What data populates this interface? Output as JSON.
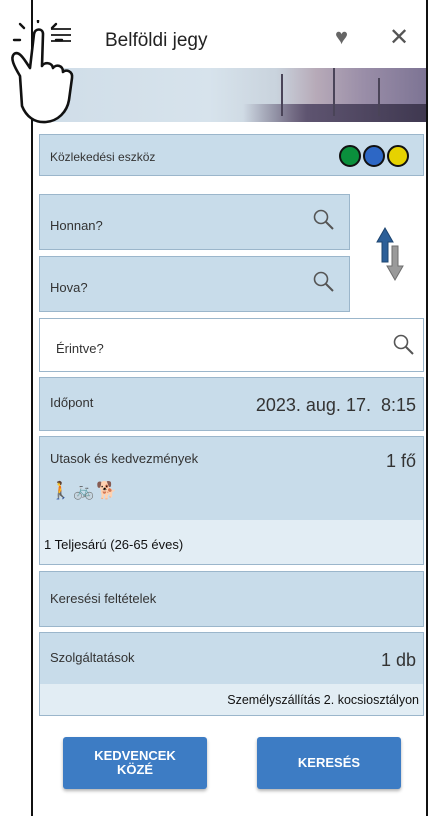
{
  "header": {
    "title": "Belföldi jegy"
  },
  "transport": {
    "label": "Közlekedési eszköz",
    "colors": {
      "train": "#0a8f3c",
      "bus": "#2d67c5",
      "other": "#e6d200"
    }
  },
  "from": {
    "placeholder": "Honnan?"
  },
  "to": {
    "placeholder": "Hova?"
  },
  "via": {
    "placeholder": "Érintve?"
  },
  "time": {
    "label": "Időpont",
    "value": "2023. aug. 17.  8:15"
  },
  "passengers": {
    "label": "Utasok és kedvezmények",
    "count": "1 fő",
    "detail": "1 Teljesárú (26-65 éves)"
  },
  "search_criteria": {
    "label": "Keresési feltételek"
  },
  "services": {
    "label": "Szolgáltatások",
    "count": "1 db",
    "detail": "Személyszállítás 2. kocsiosztályon"
  },
  "buttons": {
    "favorites_line1": "KEDVENCEK",
    "favorites_line2": "KÖZÉ",
    "search": "KERESÉS"
  },
  "colors": {
    "panel": "#c8dcea",
    "button": "#3d7cc4"
  }
}
